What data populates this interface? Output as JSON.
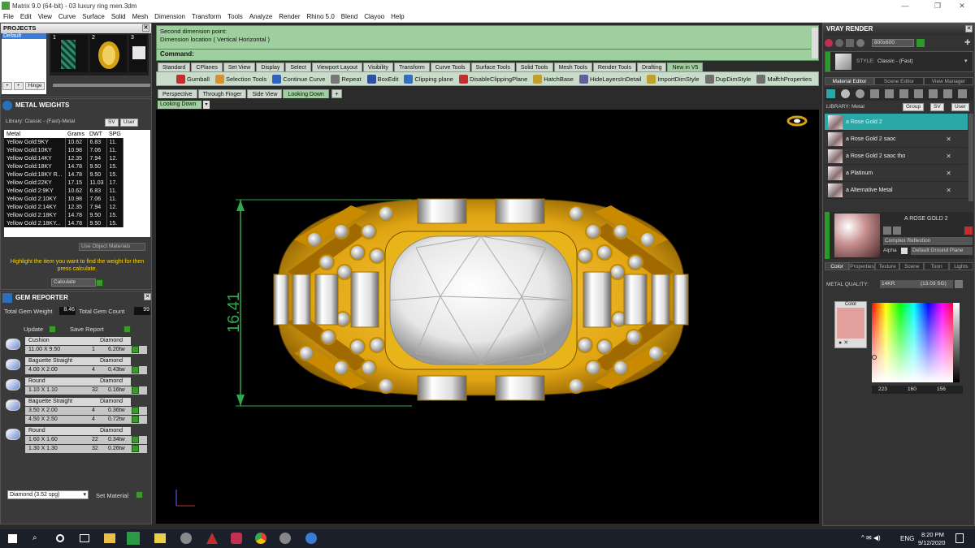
{
  "window": {
    "title": "Matrix 9.0 (64-bit) - 03 luxury ring men.3dm",
    "controls": [
      "—",
      "❐",
      "✕"
    ]
  },
  "menu": [
    "File",
    "Edit",
    "View",
    "Curve",
    "Surface",
    "Solid",
    "Mesh",
    "Dimension",
    "Transform",
    "Tools",
    "Analyze",
    "Render",
    "Rhino 5.0",
    "Blend",
    "Clayoo",
    "Help"
  ],
  "projects": {
    "title": "PROJECTS",
    "item": "Default",
    "thumbs": [
      "1",
      "2",
      "3"
    ],
    "hinge": "Hinge"
  },
  "metal_weights": {
    "title": "METAL WEIGHTS",
    "library": "Library: Classic - (Fast)-Metal",
    "sv": "SV",
    "user": "User",
    "columns": [
      "Metal",
      "Grams",
      "DWT",
      "SPG"
    ],
    "rows": [
      [
        "Yellow Gold:9KY",
        "10.62",
        "6.83",
        "11."
      ],
      [
        "Yellow Gold:10KY",
        "10.98",
        "7.06",
        "11."
      ],
      [
        "Yellow Gold:14KY",
        "12.35",
        "7.94",
        "12."
      ],
      [
        "Yellow Gold:18KY",
        "14.78",
        "9.50",
        "15."
      ],
      [
        "Yellow Gold:18KY R...",
        "14.78",
        "9.50",
        "15."
      ],
      [
        "Yellow Gold:22KY",
        "17.15",
        "11.03",
        "17."
      ],
      [
        "Yellow Gold 2:9KY",
        "10.62",
        "6.83",
        "11."
      ],
      [
        "Yellow Gold 2:10KY",
        "10.98",
        "7.06",
        "11."
      ],
      [
        "Yellow Gold 2:14KY",
        "12.35",
        "7.94",
        "12."
      ],
      [
        "Yellow Gold 2:18KY",
        "14.78",
        "9.50",
        "15."
      ],
      [
        "Yellow Gold 2:18KY...",
        "14.78",
        "9.50",
        "15."
      ]
    ],
    "use_object_materials": "Use Object Materials",
    "hint": "Highlight the item you want to find the weight for then press calculate.",
    "calculate": "Calculate"
  },
  "gem_reporter": {
    "title": "GEM REPORTER",
    "total_weight_label": "Total Gem Weight",
    "total_weight": "8.46",
    "total_count_label": "Total Gem Count",
    "total_count": "99",
    "update": "Update",
    "save_report": "Save Report",
    "groups": [
      {
        "shape": "Cushion",
        "material": "Diamond",
        "rows": [
          [
            "11.00 X 9.50",
            "1",
            "6.20tw"
          ]
        ]
      },
      {
        "shape": "Baguette Straight",
        "material": "Diamond",
        "rows": [
          [
            "4.00 X 2.00",
            "4",
            "0.43tw"
          ]
        ]
      },
      {
        "shape": "Round",
        "material": "Diamond",
        "rows": [
          [
            "1.10 X 1.10",
            "32",
            "0.16tw"
          ]
        ]
      },
      {
        "shape": "Baguette Straight",
        "material": "Diamond",
        "rows": [
          [
            "3.50 X 2.00",
            "4",
            "0.36tw"
          ],
          [
            "4.50 X 2.50",
            "4",
            "0.72tw"
          ]
        ]
      },
      {
        "shape": "Round",
        "material": "Diamond",
        "rows": [
          [
            "1.60 X 1.60",
            "22",
            "0.34tw"
          ],
          [
            "1.30 X 1.30",
            "32",
            "0.26tw"
          ]
        ]
      }
    ],
    "material_select": "Diamond   (3.52 spg)",
    "set_material": "Set Material"
  },
  "command": {
    "lines": [
      "Second dimension point:",
      "Dimension location ( Vertical  Horizontal )"
    ],
    "prompt": "Command:"
  },
  "toolbar_tabs": [
    "Standard",
    "CPlanes",
    "Set View",
    "Display",
    "Select",
    "Viewport Layout",
    "Visibility",
    "Transform",
    "Curve Tools",
    "Surface Tools",
    "Solid Tools",
    "Mesh Tools",
    "Render Tools",
    "Drafting",
    "New in V5"
  ],
  "tools": [
    {
      "label": "Gumball",
      "icon": "gumball-icon",
      "color": "#c03030"
    },
    {
      "label": "Selection Tools",
      "icon": "selection-icon",
      "color": "#d89030"
    },
    {
      "label": "Continue Curve",
      "icon": "curve-icon",
      "color": "#3060c0"
    },
    {
      "label": "Repeat",
      "icon": "repeat-icon",
      "color": "#777777"
    },
    {
      "label": "BoxEdit",
      "icon": "box-edit-icon",
      "color": "#3050a0"
    },
    {
      "label": "Clipping plane",
      "icon": "clipping-plane-icon",
      "color": "#3070c0"
    },
    {
      "label": "DisableClippingPlane",
      "icon": "disable-clipping-icon",
      "color": "#c03030"
    },
    {
      "label": "HatchBase",
      "icon": "hatch-icon",
      "color": "#c0a030"
    },
    {
      "label": "HideLayersInDetail",
      "icon": "hide-layers-icon",
      "color": "#6060a0"
    },
    {
      "label": "ImportDimStyle",
      "icon": "import-dim-icon",
      "color": "#c0a030"
    },
    {
      "label": "DupDimStyle",
      "icon": "dup-dim-icon",
      "color": "#707070"
    },
    {
      "label": "MatchProperties",
      "icon": "match-props-icon",
      "color": "#707070"
    }
  ],
  "view_tabs": [
    "Perspective",
    "Through Finger",
    "Side View",
    "Looking Down"
  ],
  "active_view": "Looking Down",
  "dimension": {
    "value": "16.41"
  },
  "vray": {
    "title": "VRAY RENDER",
    "resolution": "800x600",
    "style_label": "STYLE:",
    "style": "Classic - (Fast)",
    "tabs": [
      "Material Editor",
      "Scene Editor",
      "View Manager"
    ],
    "library_label": "LIBRARY: Metal",
    "group": "Group",
    "sv": "SV",
    "user": "User",
    "materials": [
      "a Rose Gold 2",
      "a Rose Gold 2 saoc",
      "a Rose Gold 2 saoc tho",
      "a Platinum",
      "a Alternative Metal"
    ],
    "selected_material": "A ROSE GOLD 2",
    "reflection": "Complex Reflection",
    "alpha": "Alpha",
    "ground": "Default Ground Plane",
    "prop_tabs": [
      "Color",
      "Properties",
      "Texture",
      "Scene",
      "Toon",
      "Lights"
    ],
    "metal_quality_label": "METAL QUALITY:",
    "metal_quality": "14KR",
    "metal_quality_spg": "(13.03 SG)",
    "color_label": "Color",
    "swatch": "#e3a09c",
    "rgb": [
      "223",
      "160",
      "156"
    ]
  },
  "taskbar": {
    "lang": "ENG",
    "time": "8:20 PM",
    "date": "9/12/2020"
  }
}
